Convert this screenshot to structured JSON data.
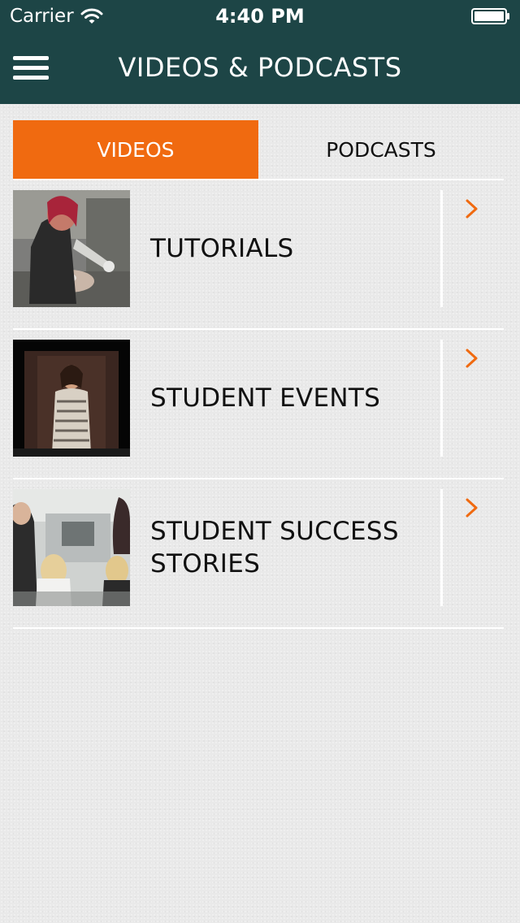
{
  "status_bar": {
    "carrier": "Carrier",
    "time": "4:40 PM",
    "wifi_icon": "wifi-icon",
    "battery_icon": "battery-icon"
  },
  "header": {
    "title": "VIDEOS & PODCASTS",
    "menu_icon": "hamburger-menu-icon",
    "background_color": "#1d4546"
  },
  "tabs": [
    {
      "label": "VIDEOS",
      "active": true
    },
    {
      "label": "PODCASTS",
      "active": false
    }
  ],
  "accent_color": "#f06a10",
  "video_categories": [
    {
      "label": "TUTORIALS",
      "thumbnail": "tutorial-thumbnail"
    },
    {
      "label": "STUDENT EVENTS",
      "thumbnail": "student-events-thumbnail"
    },
    {
      "label": "STUDENT SUCCESS STORIES",
      "thumbnail": "success-stories-thumbnail"
    }
  ]
}
